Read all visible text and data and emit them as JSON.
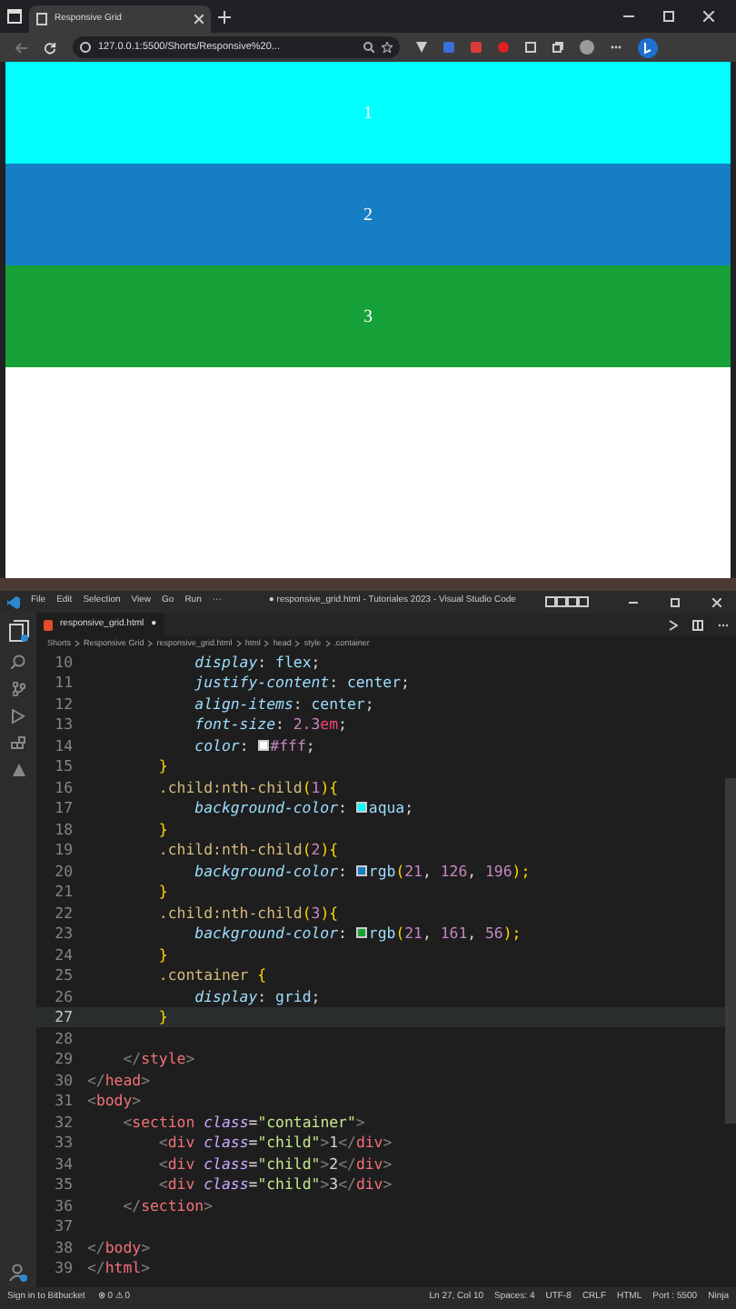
{
  "browser": {
    "tab_title": "Responsive Grid",
    "address": "127.0.0.1:5500/Shorts/Responsive%20...",
    "preview_cells": [
      {
        "text": "1",
        "color": "#00ffff"
      },
      {
        "text": "2",
        "color": "#157ec4"
      },
      {
        "text": "3",
        "color": "#15a138"
      }
    ]
  },
  "editor_window": {
    "menu": [
      "File",
      "Edit",
      "Selection",
      "View",
      "Go",
      "Run",
      "···"
    ],
    "title": "● responsive_grid.html - Tutoriales 2023 - Visual Studio Code",
    "tab": {
      "label": "responsive_grid.html",
      "dirty_mark": "●"
    },
    "breadcrumbs": [
      "Shorts",
      "Responsive Grid",
      "responsive_grid.html",
      "html",
      "head",
      "style",
      ".container"
    ],
    "lines": [
      {
        "number": "10",
        "current": false,
        "tokens": [
          {
            "text": "            display",
            "kind": "prop"
          },
          {
            "text": ": ",
            "kind": "punct"
          },
          {
            "text": "flex",
            "kind": "val"
          },
          {
            "text": ";",
            "kind": "punct"
          }
        ]
      },
      {
        "number": "11",
        "current": false,
        "tokens": [
          {
            "text": "            justify-content",
            "kind": "prop"
          },
          {
            "text": ": ",
            "kind": "punct"
          },
          {
            "text": "center",
            "kind": "val"
          },
          {
            "text": ";",
            "kind": "punct"
          }
        ]
      },
      {
        "number": "12",
        "current": false,
        "tokens": [
          {
            "text": "            align-items",
            "kind": "prop"
          },
          {
            "text": ": ",
            "kind": "punct"
          },
          {
            "text": "center",
            "kind": "val"
          },
          {
            "text": ";",
            "kind": "punct"
          }
        ]
      },
      {
        "number": "13",
        "current": false,
        "tokens": [
          {
            "text": "            font-size",
            "kind": "prop"
          },
          {
            "text": ": ",
            "kind": "punct"
          },
          {
            "text": "2.3",
            "kind": "num"
          },
          {
            "text": "em",
            "kind": "unit"
          },
          {
            "text": ";",
            "kind": "punct"
          }
        ]
      },
      {
        "number": "14",
        "current": false,
        "tokens": [
          {
            "text": "            color",
            "kind": "prop"
          },
          {
            "text": ": ",
            "kind": "punct"
          },
          {
            "kind": "swatch",
            "color": "#ffffff"
          },
          {
            "text": "#fff",
            "kind": "num"
          },
          {
            "text": ";",
            "kind": "punct"
          }
        ]
      },
      {
        "number": "15",
        "current": false,
        "tokens": [
          {
            "text": "        }",
            "kind": "brace"
          }
        ]
      },
      {
        "number": "16",
        "current": false,
        "tokens": [
          {
            "text": "        .child:nth-child",
            "kind": "sel"
          },
          {
            "text": "(",
            "kind": "brace"
          },
          {
            "text": "1",
            "kind": "num"
          },
          {
            "text": "){",
            "kind": "brace"
          }
        ]
      },
      {
        "number": "17",
        "current": false,
        "tokens": [
          {
            "text": "            background-color",
            "kind": "prop"
          },
          {
            "text": ": ",
            "kind": "punct"
          },
          {
            "kind": "swatch",
            "color": "#00ffff"
          },
          {
            "text": "aqua",
            "kind": "val"
          },
          {
            "text": ";",
            "kind": "punct"
          }
        ]
      },
      {
        "number": "18",
        "current": false,
        "tokens": [
          {
            "text": "        }",
            "kind": "brace"
          }
        ]
      },
      {
        "number": "19",
        "current": false,
        "tokens": [
          {
            "text": "        .child:nth-child",
            "kind": "sel"
          },
          {
            "text": "(",
            "kind": "brace"
          },
          {
            "text": "2",
            "kind": "num"
          },
          {
            "text": "){",
            "kind": "brace"
          }
        ]
      },
      {
        "number": "20",
        "current": false,
        "tokens": [
          {
            "text": "            background-color",
            "kind": "prop"
          },
          {
            "text": ": ",
            "kind": "punct"
          },
          {
            "kind": "swatch",
            "color": "#157ec4"
          },
          {
            "text": "rgb",
            "kind": "val"
          },
          {
            "text": "(",
            "kind": "brace"
          },
          {
            "text": "21",
            "kind": "num"
          },
          {
            "text": ", ",
            "kind": "punct"
          },
          {
            "text": "126",
            "kind": "num"
          },
          {
            "text": ", ",
            "kind": "punct"
          },
          {
            "text": "196",
            "kind": "num"
          },
          {
            "text": ");",
            "kind": "brace"
          }
        ]
      },
      {
        "number": "21",
        "current": false,
        "tokens": [
          {
            "text": "        }",
            "kind": "brace"
          }
        ]
      },
      {
        "number": "22",
        "current": false,
        "tokens": [
          {
            "text": "        .child:nth-child",
            "kind": "sel"
          },
          {
            "text": "(",
            "kind": "brace"
          },
          {
            "text": "3",
            "kind": "num"
          },
          {
            "text": "){",
            "kind": "brace"
          }
        ]
      },
      {
        "number": "23",
        "current": false,
        "tokens": [
          {
            "text": "            background-color",
            "kind": "prop"
          },
          {
            "text": ": ",
            "kind": "punct"
          },
          {
            "kind": "swatch",
            "color": "#15a138"
          },
          {
            "text": "rgb",
            "kind": "val"
          },
          {
            "text": "(",
            "kind": "brace"
          },
          {
            "text": "21",
            "kind": "num"
          },
          {
            "text": ", ",
            "kind": "punct"
          },
          {
            "text": "161",
            "kind": "num"
          },
          {
            "text": ", ",
            "kind": "punct"
          },
          {
            "text": "56",
            "kind": "num"
          },
          {
            "text": ");",
            "kind": "brace"
          }
        ]
      },
      {
        "number": "24",
        "current": false,
        "tokens": [
          {
            "text": "        }",
            "kind": "brace"
          }
        ]
      },
      {
        "number": "25",
        "current": false,
        "tokens": [
          {
            "text": "        .container ",
            "kind": "sel"
          },
          {
            "text": "{",
            "kind": "brace"
          }
        ]
      },
      {
        "number": "26",
        "current": false,
        "tokens": [
          {
            "text": "            display",
            "kind": "prop"
          },
          {
            "text": ": ",
            "kind": "punct"
          },
          {
            "text": "grid",
            "kind": "val"
          },
          {
            "text": ";",
            "kind": "punct"
          }
        ]
      },
      {
        "number": "27",
        "current": true,
        "tokens": [
          {
            "text": "        }",
            "kind": "brace"
          }
        ]
      },
      {
        "number": "28",
        "current": false
      },
      {
        "number": "29",
        "current": false,
        "tokens": [
          {
            "text": "    </",
            "kind": "bracket"
          },
          {
            "text": "style",
            "kind": "tag"
          },
          {
            "text": ">",
            "kind": "bracket"
          }
        ]
      },
      {
        "number": "30",
        "current": false,
        "tokens": [
          {
            "text": "</",
            "kind": "bracket"
          },
          {
            "text": "head",
            "kind": "tag"
          },
          {
            "text": ">",
            "kind": "bracket"
          }
        ]
      },
      {
        "number": "31",
        "current": false,
        "tokens": [
          {
            "text": "<",
            "kind": "bracket"
          },
          {
            "text": "body",
            "kind": "tag"
          },
          {
            "text": ">",
            "kind": "bracket"
          }
        ]
      },
      {
        "number": "32",
        "current": false,
        "tokens": [
          {
            "text": "    <",
            "kind": "bracket"
          },
          {
            "text": "section",
            "kind": "tag"
          },
          {
            "text": " class",
            "kind": "attr"
          },
          {
            "text": "=",
            "kind": "punct"
          },
          {
            "text": "\"container\"",
            "kind": "str"
          },
          {
            "text": ">",
            "kind": "bracket"
          }
        ]
      },
      {
        "number": "33",
        "current": false,
        "tokens": [
          {
            "text": "        <",
            "kind": "bracket"
          },
          {
            "text": "div",
            "kind": "tag"
          },
          {
            "text": " class",
            "kind": "attr"
          },
          {
            "text": "=",
            "kind": "punct"
          },
          {
            "text": "\"child\"",
            "kind": "str"
          },
          {
            "text": ">",
            "kind": "bracket"
          },
          {
            "text": "1",
            "kind": "text"
          },
          {
            "text": "</",
            "kind": "bracket"
          },
          {
            "text": "div",
            "kind": "tag"
          },
          {
            "text": ">",
            "kind": "bracket"
          }
        ]
      },
      {
        "number": "34",
        "current": false,
        "tokens": [
          {
            "text": "        <",
            "kind": "bracket"
          },
          {
            "text": "div",
            "kind": "tag"
          },
          {
            "text": " class",
            "kind": "attr"
          },
          {
            "text": "=",
            "kind": "punct"
          },
          {
            "text": "\"child\"",
            "kind": "str"
          },
          {
            "text": ">",
            "kind": "bracket"
          },
          {
            "text": "2",
            "kind": "text"
          },
          {
            "text": "</",
            "kind": "bracket"
          },
          {
            "text": "div",
            "kind": "tag"
          },
          {
            "text": ">",
            "kind": "bracket"
          }
        ]
      },
      {
        "number": "35",
        "current": false,
        "tokens": [
          {
            "text": "        <",
            "kind": "bracket"
          },
          {
            "text": "div",
            "kind": "tag"
          },
          {
            "text": " class",
            "kind": "attr"
          },
          {
            "text": "=",
            "kind": "punct"
          },
          {
            "text": "\"child\"",
            "kind": "str"
          },
          {
            "text": ">",
            "kind": "bracket"
          },
          {
            "text": "3",
            "kind": "text"
          },
          {
            "text": "</",
            "kind": "bracket"
          },
          {
            "text": "div",
            "kind": "tag"
          },
          {
            "text": ">",
            "kind": "bracket"
          }
        ]
      },
      {
        "number": "36",
        "current": false,
        "tokens": [
          {
            "text": "    </",
            "kind": "bracket"
          },
          {
            "text": "section",
            "kind": "tag"
          },
          {
            "text": ">",
            "kind": "bracket"
          }
        ]
      },
      {
        "number": "37",
        "current": false
      },
      {
        "number": "38",
        "current": false,
        "tokens": [
          {
            "text": "</",
            "kind": "bracket"
          },
          {
            "text": "body",
            "kind": "tag"
          },
          {
            "text": ">",
            "kind": "bracket"
          }
        ]
      },
      {
        "number": "39",
        "current": false,
        "tokens": [
          {
            "text": "</",
            "kind": "bracket"
          },
          {
            "text": "html",
            "kind": "tag"
          },
          {
            "text": ">",
            "kind": "bracket"
          }
        ]
      }
    ],
    "status_left": [
      "Sign in to Bitbucket",
      "⊗ 0 ⚠ 0"
    ],
    "status_right": [
      "Ln 27, Col 10",
      "Spaces: 4",
      "UTF-8",
      "CRLF",
      "HTML",
      "Port : 5500",
      "Ninja"
    ]
  }
}
